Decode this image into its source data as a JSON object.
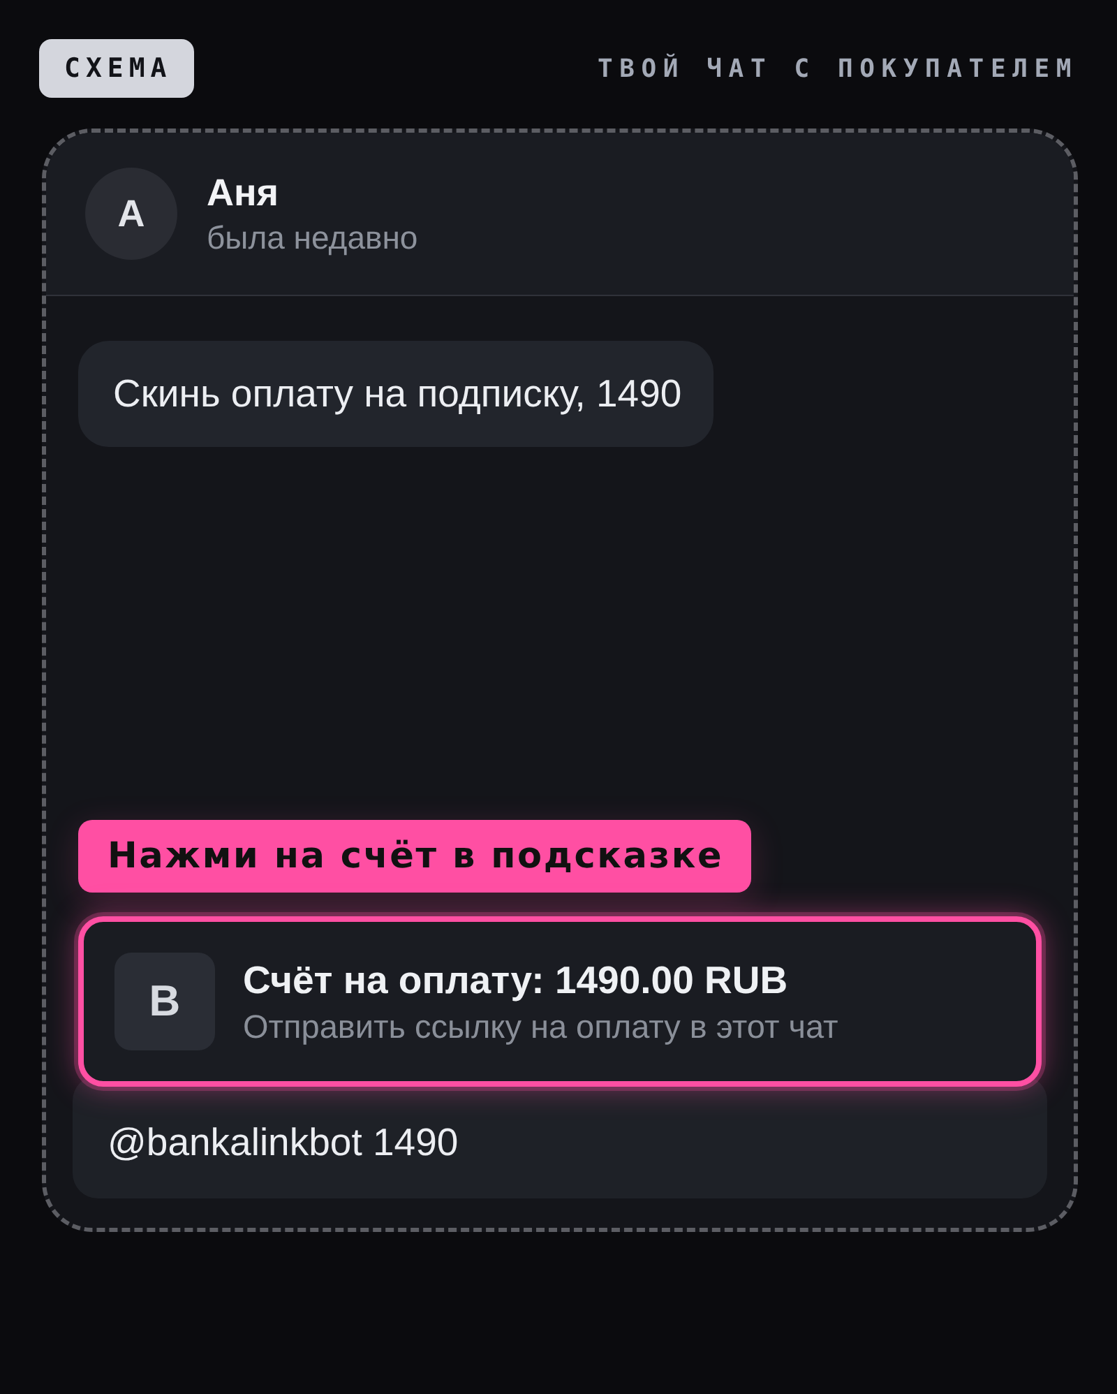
{
  "top_bar": {
    "badge": "СХЕМА",
    "caption": "ТВОЙ ЧАТ С ПОКУПАТЕЛЕМ"
  },
  "chat_header": {
    "avatar_letter": "А",
    "name": "Аня",
    "status": "была недавно"
  },
  "messages": [
    {
      "text": "Скинь оплату на подписку, 1490"
    }
  ],
  "hint": {
    "text": "Нажми на счёт в подсказке"
  },
  "suggestion": {
    "icon_letter": "B",
    "title": "Счёт на оплату: 1490.00 RUB",
    "subtitle": "Отправить ссылку на оплату в этот чат",
    "highlighted": true
  },
  "input": {
    "value": "@bankalinkbot 1490"
  }
}
